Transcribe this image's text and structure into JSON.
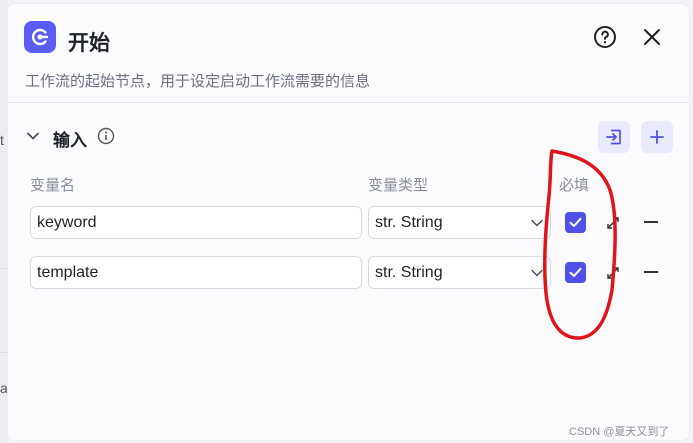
{
  "background": {
    "fragments": [
      "t",
      "a"
    ]
  },
  "dialog": {
    "title": "开始",
    "description": "工作流的起始节点，用于设定启动工作流需要的信息",
    "icons": {
      "node": "start-node-icon",
      "help": "help-icon",
      "close": "close-icon"
    },
    "accent_color": "#5b5cf2"
  },
  "input_section": {
    "title": "输入",
    "icons": {
      "collapse": "chevron-down-icon",
      "info": "info-icon",
      "import": "import-icon",
      "add": "plus-icon"
    },
    "columns": {
      "name": "变量名",
      "type": "变量类型",
      "required": "必填"
    },
    "rows": [
      {
        "name": "keyword",
        "type_prefix": "str.",
        "type": "String",
        "required": true
      },
      {
        "name": "template",
        "type_prefix": "str.",
        "type": "String",
        "required": true
      }
    ]
  },
  "annotation": {
    "color": "#e0141b"
  },
  "watermark": "CSDN @夏天又到了"
}
